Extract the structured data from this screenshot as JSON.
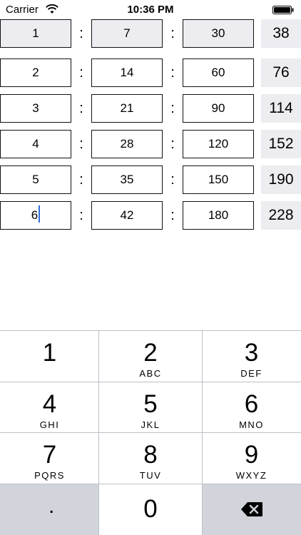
{
  "status_bar": {
    "carrier": "Carrier",
    "time": "10:36 PM",
    "wifi_icon": "wifi-icon",
    "battery_icon": "battery-icon"
  },
  "rows": [
    {
      "a": "1",
      "b": "7",
      "c": "30",
      "total": "38",
      "colon": ":"
    },
    {
      "a": "2",
      "b": "14",
      "c": "60",
      "total": "76",
      "colon": ":"
    },
    {
      "a": "3",
      "b": "21",
      "c": "90",
      "total": "114",
      "colon": ":"
    },
    {
      "a": "4",
      "b": "28",
      "c": "120",
      "total": "152",
      "colon": ":"
    },
    {
      "a": "5",
      "b": "35",
      "c": "150",
      "total": "190",
      "colon": ":"
    },
    {
      "a": "6",
      "b": "42",
      "c": "180",
      "total": "228",
      "colon": ":"
    }
  ],
  "keypad": {
    "keys": [
      {
        "digit": "1",
        "letters": ""
      },
      {
        "digit": "2",
        "letters": "ABC"
      },
      {
        "digit": "3",
        "letters": "DEF"
      },
      {
        "digit": "4",
        "letters": "GHI"
      },
      {
        "digit": "5",
        "letters": "JKL"
      },
      {
        "digit": "6",
        "letters": "MNO"
      },
      {
        "digit": "7",
        "letters": "PQRS"
      },
      {
        "digit": "8",
        "letters": "TUV"
      },
      {
        "digit": "9",
        "letters": "WXYZ"
      }
    ],
    "decimal": ".",
    "zero": "0",
    "delete_icon": "backspace-icon"
  },
  "colors": {
    "shaded_cell": "#ececf1",
    "caret": "#2f6fdb",
    "gray_key": "#d1d5db"
  }
}
